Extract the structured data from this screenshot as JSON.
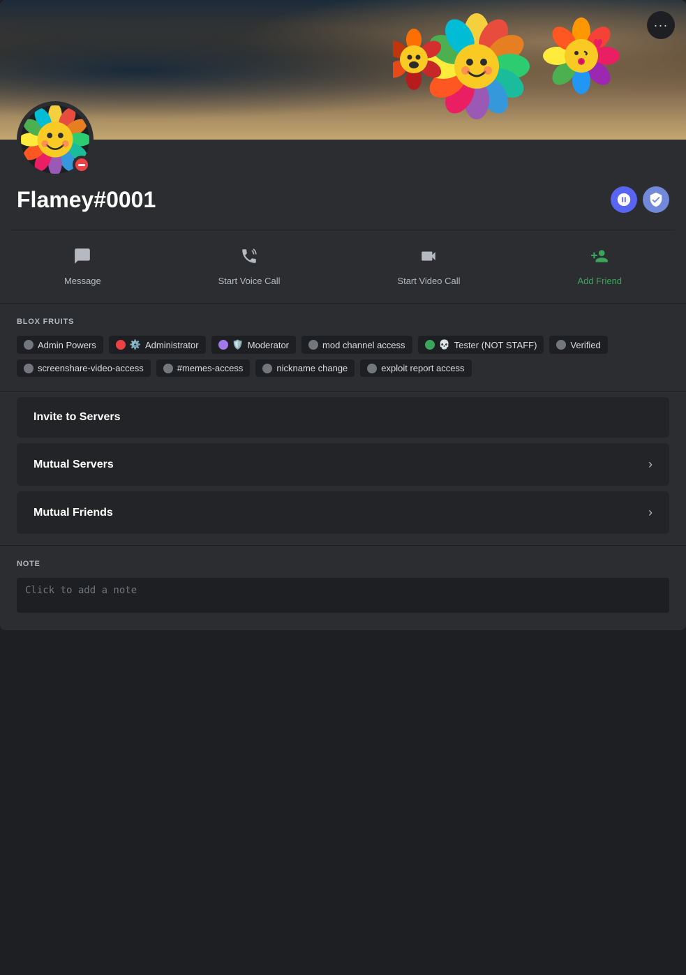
{
  "profile": {
    "username": "Flamey",
    "discriminator": "#0001",
    "avatar_emoji": "🌸",
    "status": "dnd"
  },
  "more_button": "···",
  "actions": [
    {
      "id": "message",
      "label": "Message",
      "icon": "💬",
      "green": false
    },
    {
      "id": "voice",
      "label": "Start Voice Call",
      "icon": "📞",
      "green": false
    },
    {
      "id": "video",
      "label": "Start Video Call",
      "icon": "📹",
      "green": false
    },
    {
      "id": "friend",
      "label": "Add Friend",
      "icon": "👤+",
      "green": true
    }
  ],
  "roles_section": {
    "title": "BLOX FRUITS",
    "roles": [
      {
        "id": "admin-powers",
        "label": "Admin Powers",
        "dot_color": "#72767d",
        "emoji": null
      },
      {
        "id": "administrator",
        "label": "Administrator",
        "dot_color": "#ed4245",
        "emoji": "⚙️"
      },
      {
        "id": "moderator",
        "label": "Moderator",
        "dot_color": "#a277e8",
        "emoji": "🛡️"
      },
      {
        "id": "mod-channel",
        "label": "mod channel access",
        "dot_color": "#72767d",
        "emoji": null
      },
      {
        "id": "tester",
        "label": "Tester (NOT STAFF)",
        "dot_color": "#3ba55c",
        "emoji": "💀"
      },
      {
        "id": "verified",
        "label": "Verified",
        "dot_color": "#72767d",
        "emoji": null
      },
      {
        "id": "screenshare",
        "label": "screenshare-video-access",
        "dot_color": "#72767d",
        "emoji": null
      },
      {
        "id": "memes-access",
        "label": "#memes-access",
        "dot_color": "#72767d",
        "emoji": null
      },
      {
        "id": "nickname-change",
        "label": "nickname change",
        "dot_color": "#72767d",
        "emoji": null
      },
      {
        "id": "exploit-report",
        "label": "exploit report access",
        "dot_color": "#72767d",
        "emoji": null
      }
    ]
  },
  "collapsibles": [
    {
      "id": "invite-servers",
      "label": "Invite to Servers",
      "has_chevron": false
    },
    {
      "id": "mutual-servers",
      "label": "Mutual Servers",
      "has_chevron": true
    },
    {
      "id": "mutual-friends",
      "label": "Mutual Friends",
      "has_chevron": true
    }
  ],
  "note": {
    "title": "NOTE",
    "placeholder": "Click to add a note"
  }
}
